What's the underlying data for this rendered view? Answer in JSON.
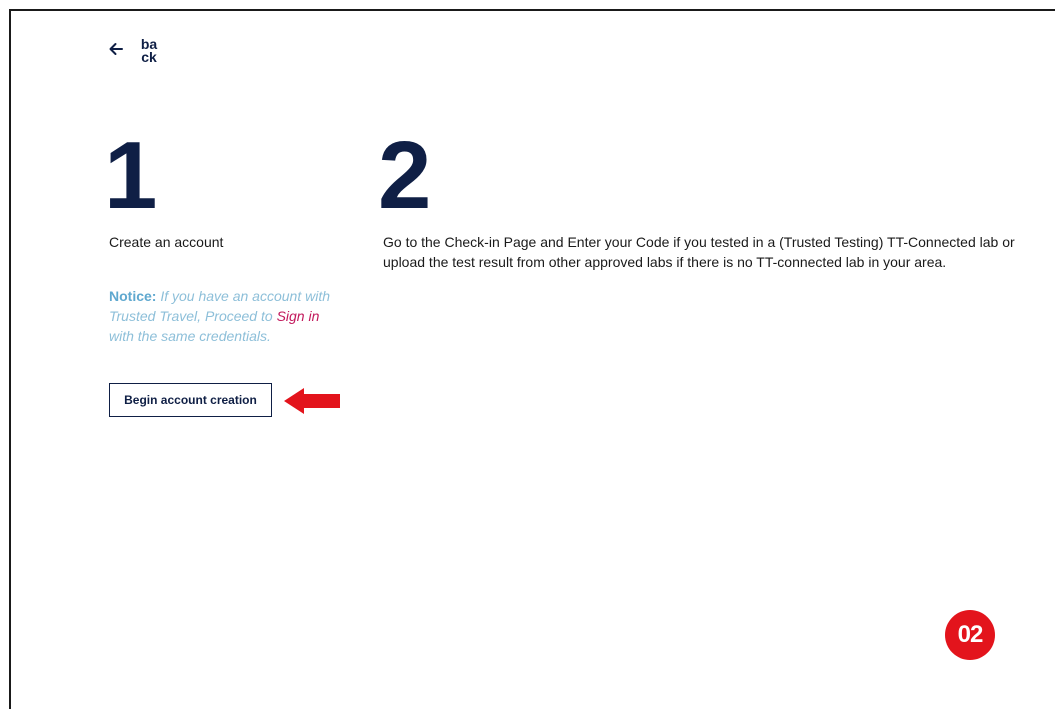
{
  "back": {
    "label": "back",
    "icon": "arrow-left-icon"
  },
  "steps": [
    {
      "number": "1",
      "text": "Create an account"
    },
    {
      "number": "2",
      "text": "Go to the Check-in Page and Enter your Code if you tested in a (Trusted Testing) TT-Connected lab or upload the test result from other approved labs if there is no TT-connected lab in your area."
    }
  ],
  "notice": {
    "label": "Notice:",
    "text_before": " If you have an account with Trusted Travel, Proceed to ",
    "link": "Sign in",
    "text_after": " with the same credentials."
  },
  "begin_button": {
    "label": "Begin account creation"
  },
  "annotation": {
    "arrow_icon": "red-arrow-left-icon",
    "badge": "02"
  },
  "colors": {
    "primary": "#0f1f45",
    "notice": "#8dbfd9",
    "link": "#c2185b",
    "annotation": "#e3141c"
  }
}
